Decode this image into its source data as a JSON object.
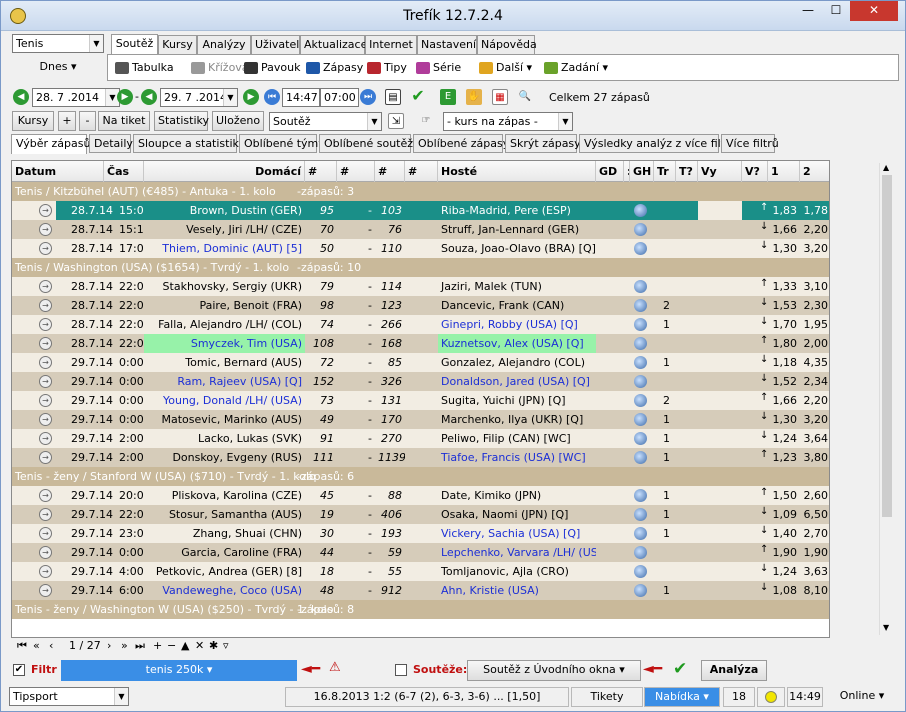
{
  "window": {
    "title": "Trefík 12.7.2.4"
  },
  "toolbar": {
    "sport": "Tenis",
    "day_selector": "Dnes",
    "menu_tabs": [
      "Soutěž",
      "Kursy",
      "Analýzy",
      "Uživatel",
      "Aktualizace",
      "Internet",
      "Nastavení",
      "Nápověda"
    ],
    "tools": [
      "Tabulka",
      "Křížová",
      "Pavouk",
      "Zápasy",
      "Tipy",
      "Série",
      "Další",
      "Zadání"
    ],
    "date_from": "28. 7 .2014",
    "date_to": "29. 7 .2014",
    "time_from": "14:47",
    "time_to": "07:00",
    "total": "Celkem 27 zápasů",
    "buttons": [
      "Kursy",
      "+",
      "-",
      "Na tiket",
      "Statistiky",
      "Uloženo"
    ],
    "competition_combo": "Soutěž",
    "odds_combo": "- kurs na zápas -"
  },
  "filter_tabs": [
    "Výběr zápasů",
    "Detaily",
    "Sloupce a statistiky",
    "Oblíbené týmy",
    "Oblíbené soutěže",
    "Oblíbené zápasy",
    "Skrýt zápasy",
    "Výsledky analýz z více filtrů",
    "Více filtrů"
  ],
  "columns": [
    "Datum",
    "Čas",
    "Domácí",
    "#",
    "#",
    "#",
    "#",
    "Hosté",
    "GD",
    ":",
    "GH",
    "Tr",
    "T?",
    "Vy",
    "V?",
    "1",
    "2"
  ],
  "groups": [
    {
      "title": "Tenis / Kitzbühel (AUT)  (€485) - Antuka - 1. kolo",
      "count": "-zápasů: 3",
      "rows": [
        {
          "date": "28.7.14",
          "time": "15:00",
          "home": "Brown, Dustin (GER)",
          "h1": "95",
          "h2": "-",
          "h3": "103",
          "away": "Riba-Madrid, Pere (ESP)",
          "tr": "",
          "o1": "1,83",
          "o2": "1,78",
          "sel": true
        },
        {
          "date": "28.7.14",
          "time": "15:10",
          "home": "Vesely, Jiri /LH/ (CZE)",
          "h1": "70",
          "h2": "-",
          "h3": "76",
          "away": "Struff, Jan-Lennard (GER)",
          "tr": "",
          "o1": "1,66",
          "o2": "2,20"
        },
        {
          "date": "28.7.14",
          "time": "17:00",
          "home": "Thiem, Dominic (AUT) [5]",
          "h1": "50",
          "h2": "-",
          "h3": "110",
          "away": "Souza, Joao-Olavo (BRA) [Q]",
          "tr": "",
          "o1": "1,30",
          "o2": "3,20",
          "homeBlue": true
        }
      ]
    },
    {
      "title": "Tenis / Washington (USA)  ($1654) - Tvrdý - 1. kolo",
      "count": "-zápasů: 10",
      "rows": [
        {
          "date": "28.7.14",
          "time": "22:00",
          "home": "Stakhovsky, Sergiy (UKR)",
          "h1": "79",
          "h2": "-",
          "h3": "114",
          "away": "Jaziri, Malek (TUN)",
          "tr": "",
          "o1": "1,33",
          "o2": "3,10"
        },
        {
          "date": "28.7.14",
          "time": "22:00",
          "home": "Paire, Benoit (FRA)",
          "h1": "98",
          "h2": "-",
          "h3": "123",
          "away": "Dancevic, Frank (CAN)",
          "tr": "2",
          "o1": "1,53",
          "o2": "2,30"
        },
        {
          "date": "28.7.14",
          "time": "22:00",
          "home": "Falla, Alejandro /LH/ (COL)",
          "h1": "74",
          "h2": "-",
          "h3": "266",
          "away": "Ginepri, Robby (USA) [Q]",
          "tr": "1",
          "o1": "1,70",
          "o2": "1,95",
          "awayBlue": true
        },
        {
          "date": "28.7.14",
          "time": "22:00",
          "home": "Smyczek, Tim (USA)",
          "h1": "108",
          "h2": "-",
          "h3": "168",
          "away": "Kuznetsov, Alex (USA) [Q]",
          "tr": "",
          "o1": "1,80",
          "o2": "2,00",
          "homeBlue": true,
          "awayBlue": true,
          "hl": true
        },
        {
          "date": "29.7.14",
          "time": "0:00",
          "home": "Tomic, Bernard (AUS)",
          "h1": "72",
          "h2": "-",
          "h3": "85",
          "away": "Gonzalez, Alejandro (COL)",
          "tr": "1",
          "o1": "1,18",
          "o2": "4,35"
        },
        {
          "date": "29.7.14",
          "time": "0:00",
          "home": "Ram, Rajeev (USA) [Q]",
          "h1": "152",
          "h2": "-",
          "h3": "326",
          "away": "Donaldson, Jared (USA) [Q]",
          "tr": "",
          "o1": "1,52",
          "o2": "2,34",
          "homeBlue": true,
          "awayBlue": true
        },
        {
          "date": "29.7.14",
          "time": "0:00",
          "home": "Young, Donald /LH/ (USA)",
          "h1": "73",
          "h2": "-",
          "h3": "131",
          "away": "Sugita, Yuichi (JPN) [Q]",
          "tr": "2",
          "o1": "1,66",
          "o2": "2,20",
          "homeBlue": true
        },
        {
          "date": "29.7.14",
          "time": "0:00",
          "home": "Matosevic, Marinko (AUS)",
          "h1": "49",
          "h2": "-",
          "h3": "170",
          "away": "Marchenko, Ilya (UKR) [Q]",
          "tr": "1",
          "o1": "1,30",
          "o2": "3,20"
        },
        {
          "date": "29.7.14",
          "time": "2:00",
          "home": "Lacko, Lukas (SVK)",
          "h1": "91",
          "h2": "-",
          "h3": "270",
          "away": "Peliwo, Filip (CAN) [WC]",
          "tr": "1",
          "o1": "1,24",
          "o2": "3,64"
        },
        {
          "date": "29.7.14",
          "time": "2:00",
          "home": "Donskoy, Evgeny (RUS)",
          "h1": "111",
          "h2": "-",
          "h3": "1139",
          "away": "Tiafoe, Francis (USA) [WC]",
          "tr": "1",
          "o1": "1,23",
          "o2": "3,80",
          "awayBlue": true
        }
      ]
    },
    {
      "title": "Tenis - ženy / Stanford W (USA)  ($710) - Tvrdý - 1. kolo",
      "count": "-zápasů: 6",
      "rows": [
        {
          "date": "29.7.14",
          "time": "20:00",
          "home": "Pliskova, Karolina (CZE)",
          "h1": "45",
          "h2": "-",
          "h3": "88",
          "away": "Date, Kimiko (JPN)",
          "tr": "1",
          "o1": "1,50",
          "o2": "2,60"
        },
        {
          "date": "29.7.14",
          "time": "22:00",
          "home": "Stosur, Samantha (AUS)",
          "h1": "19",
          "h2": "-",
          "h3": "406",
          "away": "Osaka, Naomi (JPN) [Q]",
          "tr": "1",
          "o1": "1,09",
          "o2": "6,50"
        },
        {
          "date": "29.7.14",
          "time": "23:00",
          "home": "Zhang, Shuai (CHN)",
          "h1": "30",
          "h2": "-",
          "h3": "193",
          "away": "Vickery, Sachia (USA) [Q]",
          "tr": "1",
          "o1": "1,40",
          "o2": "2,70",
          "awayBlue": true
        },
        {
          "date": "29.7.14",
          "time": "0:00",
          "home": "Garcia, Caroline (FRA)",
          "h1": "44",
          "h2": "-",
          "h3": "59",
          "away": "Lepchenko, Varvara /LH/ (USA)",
          "tr": "",
          "o1": "1,90",
          "o2": "1,90",
          "awayBlue": true
        },
        {
          "date": "29.7.14",
          "time": "4:00",
          "home": "Petkovic, Andrea (GER) [8]",
          "h1": "18",
          "h2": "-",
          "h3": "55",
          "away": "Tomljanovic, Ajla (CRO)",
          "tr": "",
          "o1": "1,24",
          "o2": "3,63"
        },
        {
          "date": "29.7.14",
          "time": "6:00",
          "home": "Vandeweghe, Coco (USA)",
          "h1": "48",
          "h2": "-",
          "h3": "912",
          "away": "Ahn, Kristie (USA)",
          "tr": "1",
          "o1": "1,08",
          "o2": "8,10",
          "homeBlue": true,
          "awayBlue": true
        }
      ]
    },
    {
      "title": "Tenis - ženy / Washington W (USA)  ($250) - Tvrdý - 1. kolo",
      "count": "-zápasů: 8",
      "rows": []
    }
  ],
  "pager": {
    "page": "1 / 27"
  },
  "filterbar": {
    "filtr_label": "Filtr",
    "filter_value": "tenis 250k",
    "soutez_label": "Soutěže:",
    "soutez_value": "Soutěž z Úvodního okna",
    "analyza": "Analýza"
  },
  "status": {
    "bookmaker": "Tipsport",
    "last": "16.8.2013 1:2 (6-7 (2), 6-3, 3-6) ... [1,50]",
    "tikety": "Tikety",
    "nabidka": "Nabídka",
    "count": "18",
    "time": "14:49",
    "online": "Online"
  }
}
